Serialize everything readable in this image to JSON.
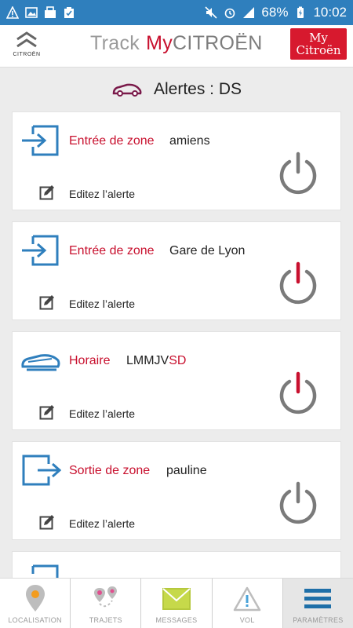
{
  "status_bar": {
    "battery": "68%",
    "time": "10:02"
  },
  "header": {
    "logo_word": "CITROËN",
    "title_track": "Track",
    "title_my": "My",
    "title_citroen": "CITROËN",
    "badge_line1": "My",
    "badge_line2": "Citroën"
  },
  "section": {
    "title": "Alertes : DS"
  },
  "alerts": [
    {
      "type_icon": "zone-entry-icon",
      "type_label": "Entrée de zone",
      "value": "amiens",
      "edit_label": "Editez l’alerte",
      "enabled": false
    },
    {
      "type_icon": "zone-entry-icon",
      "type_label": "Entrée de zone",
      "value": "Gare de Lyon",
      "edit_label": "Editez l’alerte",
      "enabled": true
    },
    {
      "type_icon": "car-schedule-icon",
      "type_label": "Horaire",
      "value_main": "LMMJV",
      "value_red": "SD",
      "edit_label": "Editez l’alerte",
      "enabled": true
    },
    {
      "type_icon": "zone-exit-icon",
      "type_label": "Sortie de zone",
      "value": "pauline",
      "edit_label": "Editez l’alerte",
      "enabled": false
    }
  ],
  "nav": [
    {
      "label": "LOCALISATION",
      "icon": "location-pin-icon"
    },
    {
      "label": "TRAJETS",
      "icon": "route-icon"
    },
    {
      "label": "MESSAGES",
      "icon": "mail-icon"
    },
    {
      "label": "VOL",
      "icon": "warning-icon"
    },
    {
      "label": "PARAMÈTRES",
      "icon": "menu-icon"
    }
  ],
  "colors": {
    "status_bar": "#2f7fbd",
    "brand_red": "#c8102e",
    "icon_blue": "#2f7fbd",
    "power_off": "#7a7a7a",
    "power_on_accent": "#c8102e"
  }
}
